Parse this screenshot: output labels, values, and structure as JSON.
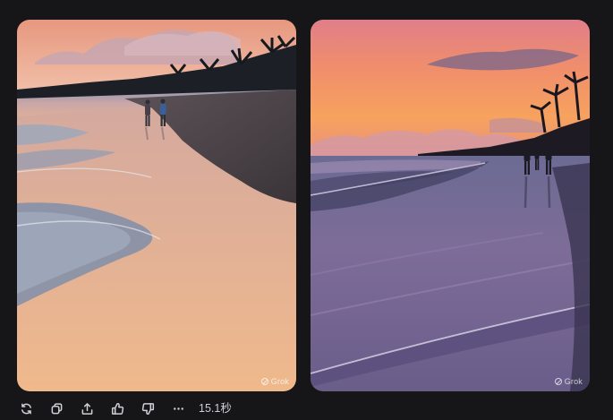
{
  "images": [
    {
      "watermark": "Grok"
    },
    {
      "watermark": "Grok"
    }
  ],
  "toolbar": {
    "buttons": [
      {
        "name": "regenerate",
        "icon": "refresh-icon"
      },
      {
        "name": "copy",
        "icon": "copy-icon"
      },
      {
        "name": "share",
        "icon": "share-icon"
      },
      {
        "name": "like",
        "icon": "thumbs-up-icon"
      },
      {
        "name": "dislike",
        "icon": "thumbs-down-icon"
      },
      {
        "name": "more",
        "icon": "more-icon"
      }
    ],
    "timing": "15.1秒"
  },
  "colors": {
    "background": "#161618",
    "icon": "#cfcfd4"
  }
}
